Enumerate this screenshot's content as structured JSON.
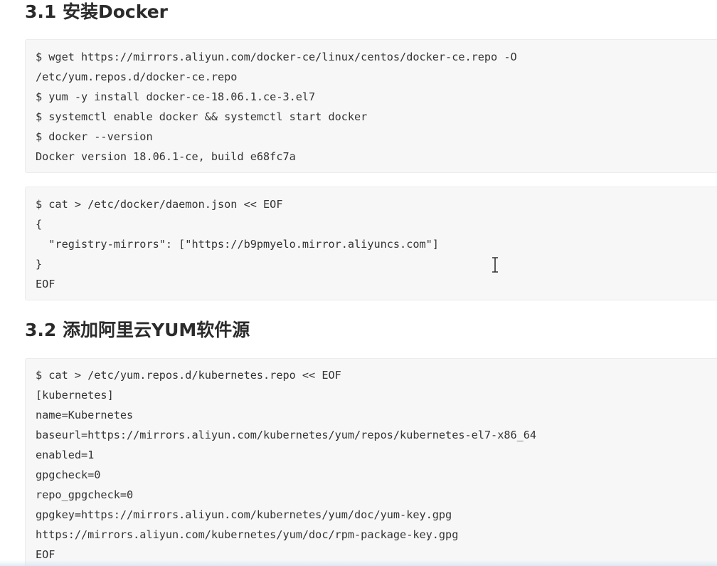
{
  "sections": [
    {
      "heading": "3.1 安装Docker",
      "blocks": [
        {
          "lines": [
            "$ wget https://mirrors.aliyun.com/docker-ce/linux/centos/docker-ce.repo -O",
            "/etc/yum.repos.d/docker-ce.repo",
            "$ yum -y install docker-ce-18.06.1.ce-3.el7",
            "$ systemctl enable docker && systemctl start docker",
            "$ docker --version",
            "Docker version 18.06.1-ce, build e68fc7a"
          ]
        },
        {
          "lines": [
            "$ cat > /etc/docker/daemon.json << EOF",
            "{",
            "  \"registry-mirrors\": [\"https://b9pmyelo.mirror.aliyuncs.com\"]",
            "}",
            "EOF"
          ]
        }
      ]
    },
    {
      "heading": "3.2 添加阿里云YUM软件源",
      "blocks": [
        {
          "lines": [
            "$ cat > /etc/yum.repos.d/kubernetes.repo << EOF",
            "[kubernetes]",
            "name=Kubernetes",
            "baseurl=https://mirrors.aliyun.com/kubernetes/yum/repos/kubernetes-el7-x86_64",
            "enabled=1",
            "gpgcheck=0",
            "repo_gpgcheck=0",
            "gpgkey=https://mirrors.aliyun.com/kubernetes/yum/doc/yum-key.gpg",
            "https://mirrors.aliyun.com/kubernetes/yum/doc/rpm-package-key.gpg",
            "EOF"
          ]
        }
      ]
    }
  ],
  "colors": {
    "heading": "#2b2b2b",
    "code_background": "#f7f7f7",
    "code_border": "#ececec",
    "code_text": "#333333"
  },
  "icons": {
    "cursor": "text-cursor-icon"
  }
}
